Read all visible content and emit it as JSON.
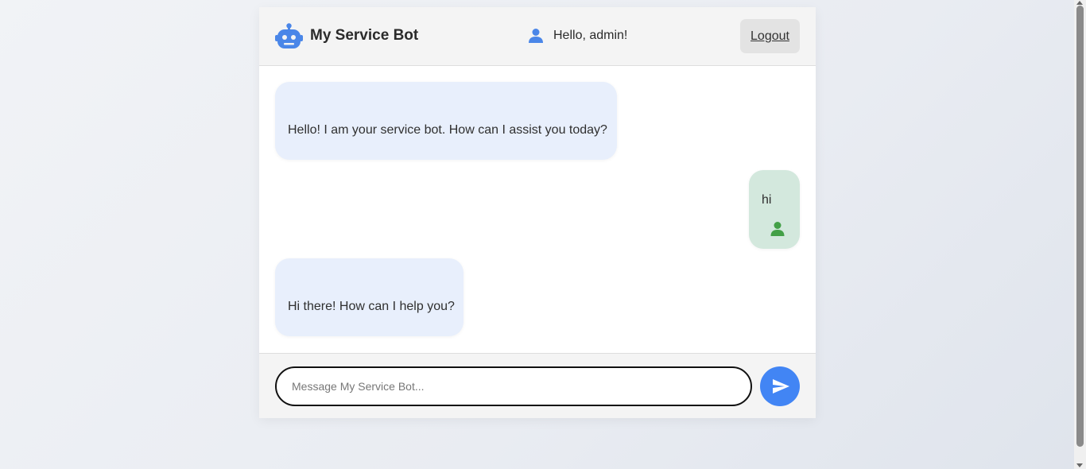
{
  "header": {
    "title": "My Service Bot",
    "brand_icon": "robot-icon",
    "greeting": "Hello, admin!",
    "greeting_icon": "user-icon",
    "logout_label": "Logout"
  },
  "messages": [
    {
      "sender": "bot",
      "text": "Hello! I am your service bot. How can I assist you today?"
    },
    {
      "sender": "user",
      "text": "hi",
      "icon": "user-icon"
    },
    {
      "sender": "bot",
      "text": "Hi there! How can I help you?"
    }
  ],
  "composer": {
    "placeholder": "Message My Service Bot...",
    "value": "",
    "send_icon": "send-icon"
  },
  "colors": {
    "accent": "#4285f4",
    "bot_bubble": "#e8effc",
    "user_bubble": "#d3e8dd",
    "user_icon": "#43a047",
    "header_bg": "#f4f4f4"
  }
}
